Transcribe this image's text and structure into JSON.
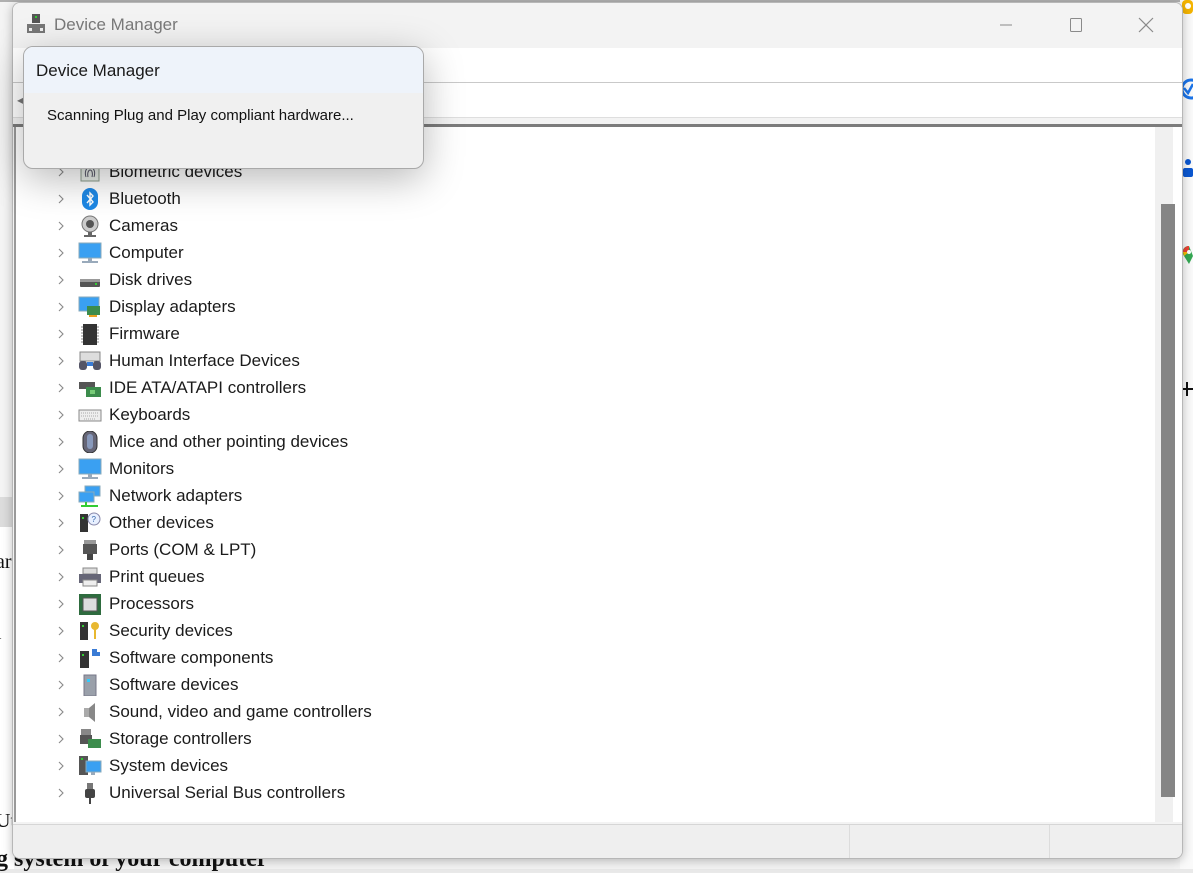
{
  "window": {
    "title": "Device Manager",
    "controls": {
      "minimize": "minimize",
      "maximize": "maximize",
      "close": "close"
    }
  },
  "dialog": {
    "title": "Device Manager",
    "message": "Scanning Plug and Play compliant hardware..."
  },
  "tree": {
    "items": [
      {
        "label": "Biometric devices",
        "icon": "fingerprint-icon"
      },
      {
        "label": "Bluetooth",
        "icon": "bluetooth-icon"
      },
      {
        "label": "Cameras",
        "icon": "webcam-icon"
      },
      {
        "label": "Computer",
        "icon": "computer-monitor-icon"
      },
      {
        "label": "Disk drives",
        "icon": "disk-drive-icon"
      },
      {
        "label": "Display adapters",
        "icon": "display-adapter-icon"
      },
      {
        "label": "Firmware",
        "icon": "chip-icon"
      },
      {
        "label": "Human Interface Devices",
        "icon": "hid-icon"
      },
      {
        "label": "IDE ATA/ATAPI controllers",
        "icon": "ide-controller-icon"
      },
      {
        "label": "Keyboards",
        "icon": "keyboard-icon"
      },
      {
        "label": "Mice and other pointing devices",
        "icon": "mouse-icon"
      },
      {
        "label": "Monitors",
        "icon": "monitor-icon"
      },
      {
        "label": "Network adapters",
        "icon": "network-icon"
      },
      {
        "label": "Other devices",
        "icon": "unknown-device-icon"
      },
      {
        "label": "Ports (COM & LPT)",
        "icon": "port-icon"
      },
      {
        "label": "Print queues",
        "icon": "printer-icon"
      },
      {
        "label": "Processors",
        "icon": "processor-icon"
      },
      {
        "label": "Security devices",
        "icon": "security-key-icon"
      },
      {
        "label": "Software components",
        "icon": "software-component-icon"
      },
      {
        "label": "Software devices",
        "icon": "software-device-icon"
      },
      {
        "label": "Sound, video and game controllers",
        "icon": "speaker-icon"
      },
      {
        "label": "Storage controllers",
        "icon": "storage-controller-icon"
      },
      {
        "label": "System devices",
        "icon": "system-devices-icon"
      },
      {
        "label": "Universal Serial Bus controllers",
        "icon": "usb-icon"
      }
    ]
  },
  "background": {
    "fragment_1": "ar",
    "fragment_2": "l",
    "fragment_3": "Ut",
    "bottom_text": "g system of your computer"
  },
  "colors": {
    "accent_blue": "#0078d4",
    "scrollbar_thumb": "#858585"
  }
}
